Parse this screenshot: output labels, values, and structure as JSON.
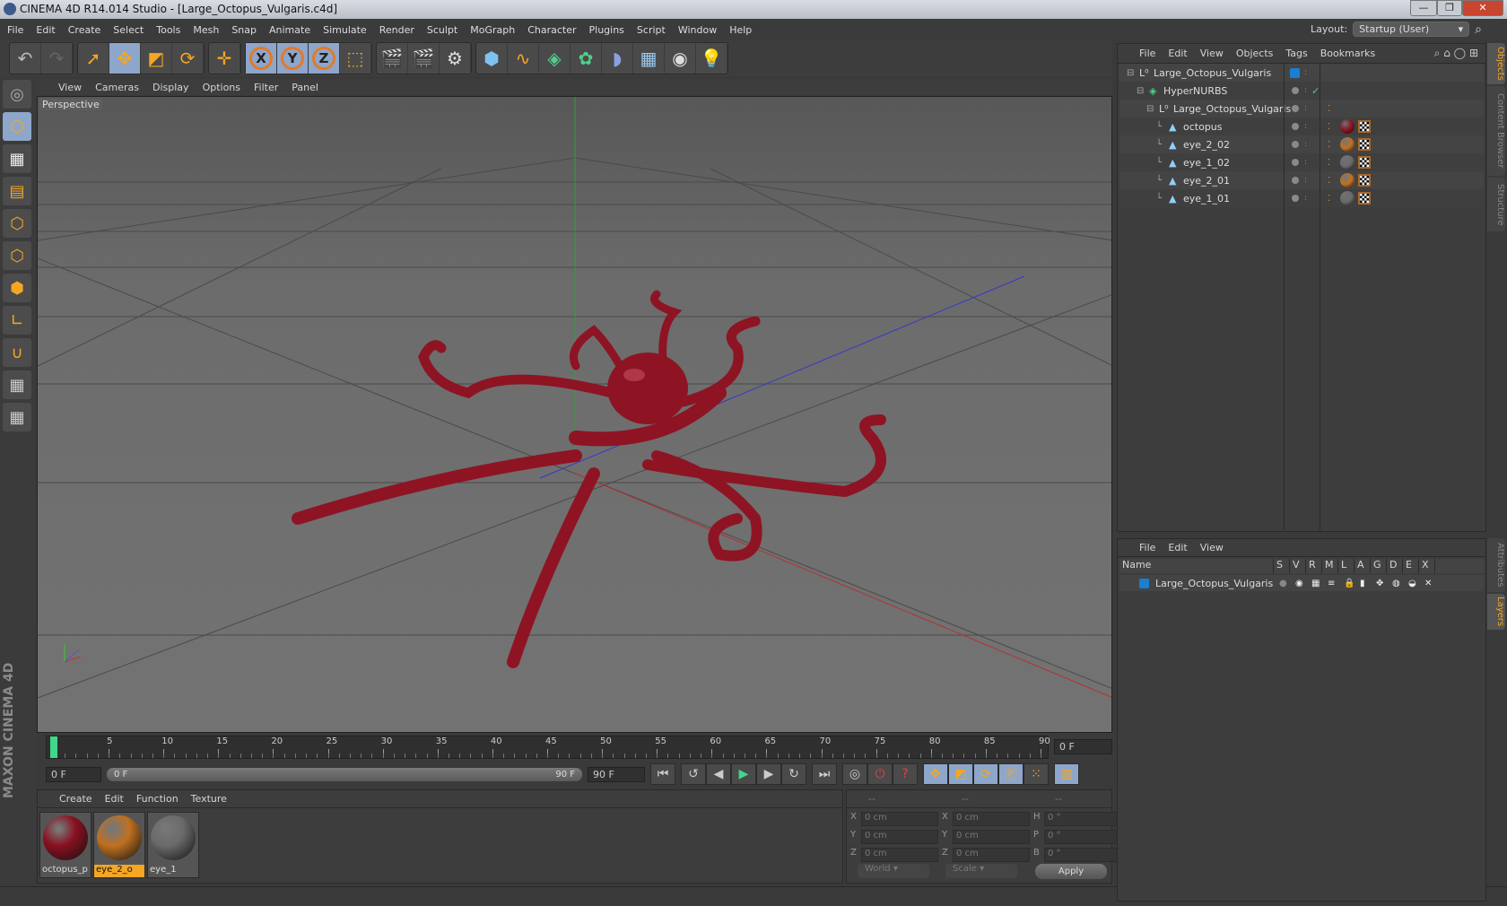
{
  "title": "CINEMA 4D R14.014 Studio - [Large_Octopus_Vulgaris.c4d]",
  "menu": [
    "File",
    "Edit",
    "Create",
    "Select",
    "Tools",
    "Mesh",
    "Snap",
    "Animate",
    "Simulate",
    "Render",
    "Sculpt",
    "MoGraph",
    "Character",
    "Plugins",
    "Script",
    "Window",
    "Help"
  ],
  "layout": {
    "label": "Layout:",
    "value": "Startup (User)"
  },
  "viewport": {
    "menu": [
      "View",
      "Cameras",
      "Display",
      "Options",
      "Filter",
      "Panel"
    ],
    "label": "Perspective"
  },
  "timeline": {
    "ticks": [
      "0",
      "5",
      "10",
      "15",
      "20",
      "25",
      "30",
      "35",
      "40",
      "45",
      "50",
      "55",
      "60",
      "65",
      "70",
      "75",
      "80",
      "85",
      "90"
    ],
    "current": "0 F",
    "start": "0 F",
    "range_start": "0 F",
    "range_end": "90 F",
    "end": "90 F",
    "playhead": 0
  },
  "materials": {
    "menu": [
      "Create",
      "Edit",
      "Function",
      "Texture"
    ],
    "items": [
      {
        "name": "octopus_p",
        "color": "#8a1020"
      },
      {
        "name": "eye_2_o",
        "color": "#c07020",
        "selected": true
      },
      {
        "name": "eye_1",
        "color": "#6a6a6a"
      }
    ]
  },
  "coords": {
    "headers": [
      "--",
      "--",
      "--"
    ],
    "rows": [
      {
        "a": "X",
        "av": "0 cm",
        "b": "X",
        "bv": "0 cm",
        "c": "H",
        "cv": "0 °"
      },
      {
        "a": "Y",
        "av": "0 cm",
        "b": "Y",
        "bv": "0 cm",
        "c": "P",
        "cv": "0 °"
      },
      {
        "a": "Z",
        "av": "0 cm",
        "b": "Z",
        "bv": "0 cm",
        "c": "B",
        "cv": "0 °"
      }
    ],
    "mode": "World",
    "transform": "Scale",
    "apply": "Apply"
  },
  "objects": {
    "menu": [
      "File",
      "Edit",
      "View",
      "Objects",
      "Tags",
      "Bookmarks"
    ],
    "items": [
      {
        "name": "Large_Octopus_Vulgaris",
        "depth": 0,
        "icon": "null-icon"
      },
      {
        "name": "HyperNURBS",
        "depth": 1,
        "icon": "hypernurbs-icon"
      },
      {
        "name": "Large_Octopus_Vulgaris",
        "depth": 2,
        "icon": "null-icon"
      },
      {
        "name": "octopus",
        "depth": 3,
        "icon": "polygon-icon",
        "mat": "#8a1020"
      },
      {
        "name": "eye_2_02",
        "depth": 3,
        "icon": "polygon-icon",
        "mat": "#c07020"
      },
      {
        "name": "eye_1_02",
        "depth": 3,
        "icon": "polygon-icon",
        "mat": "#6a6a6a"
      },
      {
        "name": "eye_2_01",
        "depth": 3,
        "icon": "polygon-icon",
        "mat": "#c07020"
      },
      {
        "name": "eye_1_01",
        "depth": 3,
        "icon": "polygon-icon",
        "mat": "#6a6a6a"
      }
    ]
  },
  "layers": {
    "menu": [
      "File",
      "Edit",
      "View"
    ],
    "columns": [
      "Name",
      "S",
      "V",
      "R",
      "M",
      "L",
      "A",
      "G",
      "D",
      "E",
      "X"
    ],
    "items": [
      {
        "name": "Large_Octopus_Vulgaris",
        "color": "#1a7fd0"
      }
    ]
  },
  "side_tabs": {
    "top": [
      "Objects",
      "Content Browser",
      "Structure"
    ],
    "bottom": [
      "Attributes",
      "Layers"
    ]
  },
  "brand": "MAXON CINEMA 4D"
}
